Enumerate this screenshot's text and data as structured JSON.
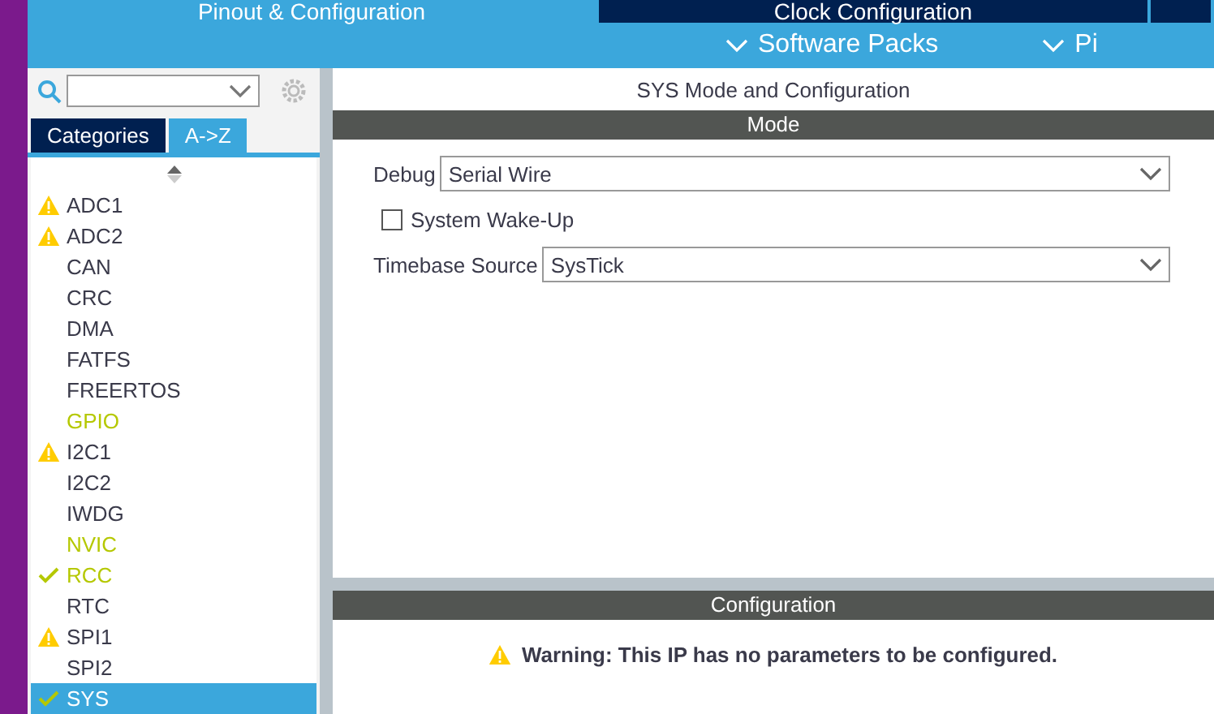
{
  "top_tabs": [
    {
      "label": "Pinout & Configuration",
      "selected": true
    },
    {
      "label": "Clock Configuration",
      "selected": false
    },
    {
      "selected": false
    }
  ],
  "sub_menus": [
    "Software Packs",
    "Pi"
  ],
  "sidebar": {
    "tabs": [
      {
        "label": "Categories",
        "selected": false
      },
      {
        "label": "A->Z",
        "selected": true
      }
    ],
    "items": [
      {
        "label": "ADC1",
        "kind": "warning",
        "highlighted": false,
        "selected": false
      },
      {
        "label": "ADC2",
        "kind": "warning",
        "highlighted": false,
        "selected": false
      },
      {
        "label": "CAN",
        "kind": "none",
        "highlighted": false,
        "selected": false
      },
      {
        "label": "CRC",
        "kind": "none",
        "highlighted": false,
        "selected": false
      },
      {
        "label": "DMA",
        "kind": "none",
        "highlighted": false,
        "selected": false
      },
      {
        "label": "FATFS",
        "kind": "none",
        "highlighted": false,
        "selected": false
      },
      {
        "label": "FREERTOS",
        "kind": "none",
        "highlighted": false,
        "selected": false
      },
      {
        "label": "GPIO",
        "kind": "none",
        "highlighted": true,
        "selected": false
      },
      {
        "label": "I2C1",
        "kind": "warning",
        "highlighted": false,
        "selected": false
      },
      {
        "label": "I2C2",
        "kind": "none",
        "highlighted": false,
        "selected": false
      },
      {
        "label": "IWDG",
        "kind": "none",
        "highlighted": false,
        "selected": false
      },
      {
        "label": "NVIC",
        "kind": "none",
        "highlighted": true,
        "selected": false
      },
      {
        "label": "RCC",
        "kind": "check",
        "highlighted": true,
        "selected": false
      },
      {
        "label": "RTC",
        "kind": "none",
        "highlighted": false,
        "selected": false
      },
      {
        "label": "SPI1",
        "kind": "warning",
        "highlighted": false,
        "selected": false
      },
      {
        "label": "SPI2",
        "kind": "none",
        "highlighted": false,
        "selected": false
      },
      {
        "label": "SYS",
        "kind": "check",
        "highlighted": true,
        "selected": true
      }
    ]
  },
  "panel": {
    "title": "SYS Mode and Configuration",
    "mode_header": "Mode",
    "debug": {
      "label": "Debug",
      "value": "Serial Wire"
    },
    "wake_up": {
      "label": "System Wake-Up",
      "checked": false
    },
    "timebase": {
      "label": "Timebase Source",
      "value": "SysTick"
    },
    "config_header": "Configuration",
    "warning": "Warning: This IP has no parameters to be configured."
  }
}
